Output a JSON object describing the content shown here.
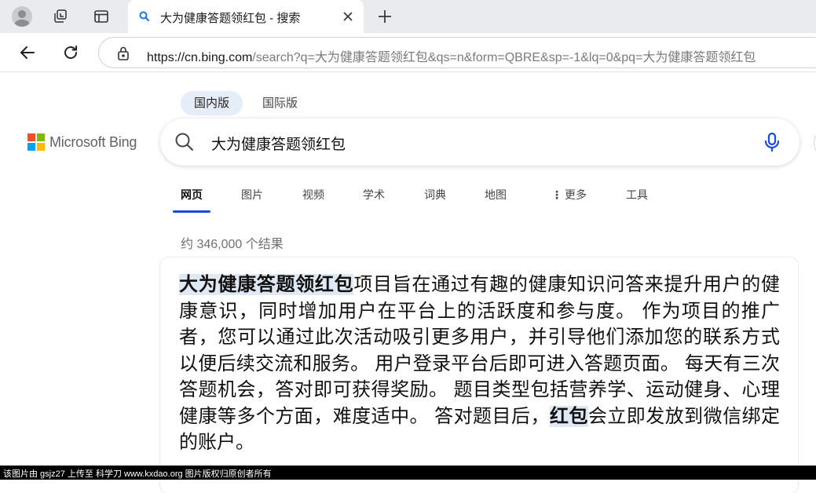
{
  "browser": {
    "tab_title": "大为健康答题领红包 - 搜索",
    "url_host": "https://cn.bing.com",
    "url_rest": "/search?q=大为健康答题领红包&qs=n&form=QBRE&sp=-1&lq=0&pq=大为健康答题领红包"
  },
  "scope_tabs": [
    "国内版",
    "国际版"
  ],
  "logo_text": "Microsoft Bing",
  "search": {
    "query": "大为健康答题领红包"
  },
  "verticals": [
    "网页",
    "图片",
    "视频",
    "学术",
    "词典",
    "地图",
    "更多",
    "工具"
  ],
  "result_count": "约 346,000 个结果",
  "answer": {
    "highlight_title": "大为健康答题领红包",
    "text_1": "项目旨在通过有趣的健康知识问答来提升用户的健康意识，同时增加用户在平台上的活跃度和参与度。 作为项目的推广者，您可以通过此次活动吸引更多用户，并引导他们添加您的联系方式以便后续交流和服务。 用户登录平台后即可进入答题页面。 每天有三次答题机会，答对即可获得奖励。 题目类型包括营养学、运动健身、心理健康等多个方面，难度适中。 答对题目后，",
    "highlight_word": "红包",
    "text_2": "会立即发放到微信绑定的账户。"
  },
  "footer_text": "该图片由 gsjz27 上传至 科学刀 www.kxdao.org 图片版权归原创者所有",
  "colors": {
    "accent": "#174ae4",
    "highlight": "#dfe8f3"
  }
}
